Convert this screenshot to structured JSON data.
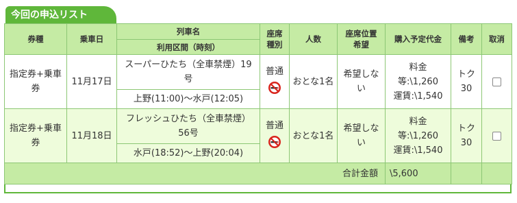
{
  "section_title": "今回の申込リスト",
  "headers": {
    "ticket_type": "券種",
    "board_date": "乗車日",
    "train_name": "列車名",
    "section_time": "利用区間（時刻）",
    "seat_type": "座席\n種別",
    "persons": "人数",
    "seat_pref": "座席位置\n希望",
    "price": "購入予定代金",
    "notes": "備考",
    "cancel": "取消"
  },
  "rows": [
    {
      "ticket_type": "指定券+乗車\n券",
      "date": "11月17日",
      "train": "スーパーひたち（全車禁煙）19\n号",
      "section": "上野(11:00)〜水戸(12:05)",
      "seat_type": "普通",
      "icon": "no-smoking-icon",
      "persons": "おとな1名",
      "seat_pref": "希望しな\nい",
      "price": "料金\n等:\\1,260\n運賃:\\1,540",
      "notes": "トク\n30"
    },
    {
      "ticket_type": "指定券+乗車\n券",
      "date": "11月18日",
      "train": "フレッシュひたち（全車禁煙）\n56号",
      "section": "水戸(18:52)〜上野(20:04)",
      "seat_type": "普通",
      "icon": "no-smoking-icon",
      "persons": "おとな1名",
      "seat_pref": "希望しな\nい",
      "price": "料金\n等:\\1,260\n運賃:\\1,540",
      "notes": "トク\n30"
    }
  ],
  "total": {
    "label": "合計金額",
    "value": "\\5,600"
  },
  "colors": {
    "accent": "#5fb73a",
    "header_bg": "#c5eba4",
    "row_alt_bg": "#eefcdb",
    "border": "#8cc774"
  }
}
